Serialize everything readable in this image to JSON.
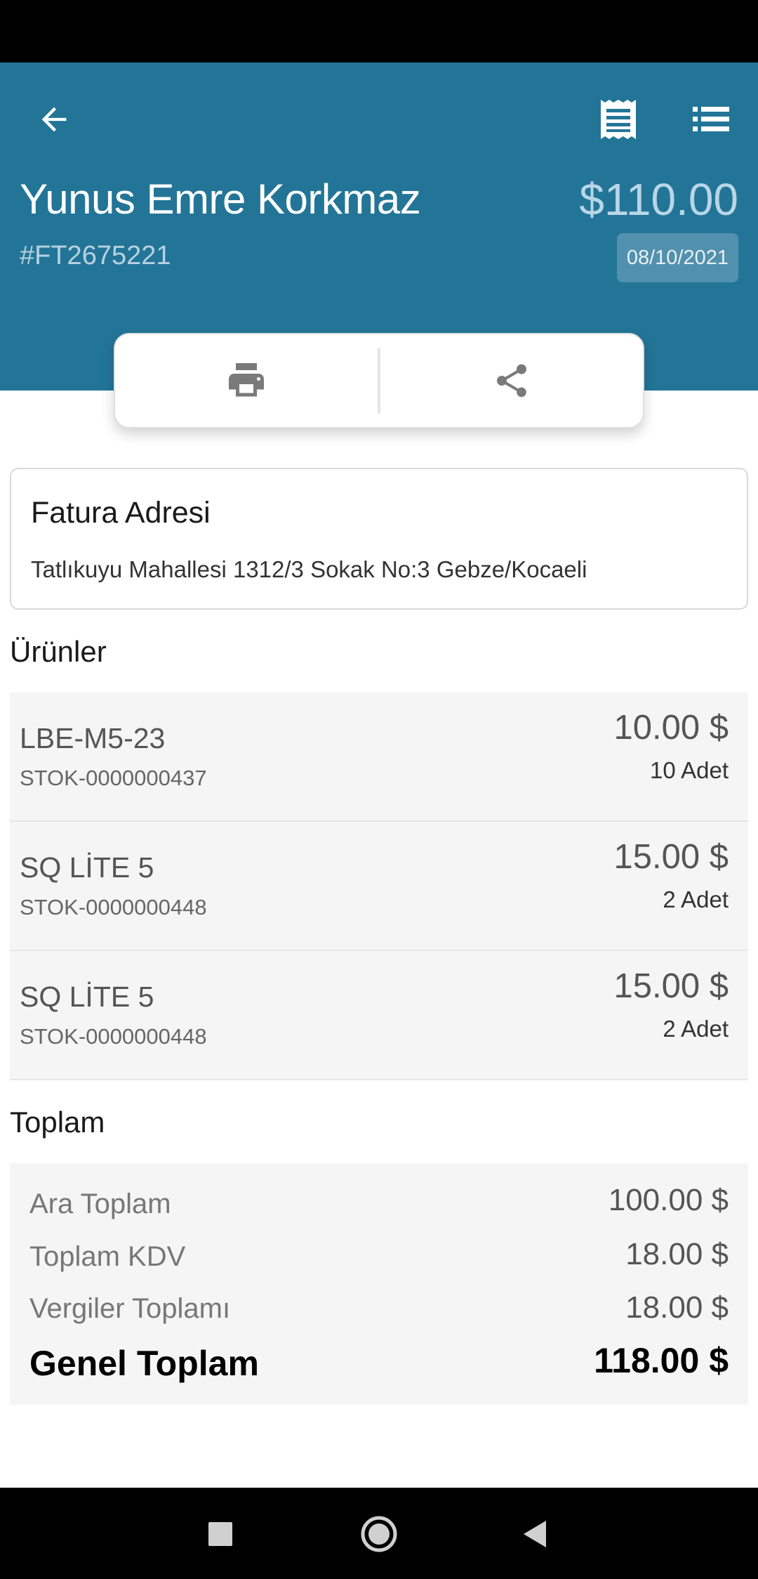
{
  "header": {
    "customer_name": "Yunus Emre Korkmaz",
    "invoice_number": "#FT2675221",
    "total_amount": "$110.00",
    "date": "08/10/2021",
    "icons": [
      "back-arrow-icon",
      "receipt-icon",
      "list-icon"
    ]
  },
  "actions": {
    "icons": [
      "print-icon",
      "share-icon"
    ]
  },
  "address": {
    "title": "Fatura Adresi",
    "text": "Tatlıkuyu Mahallesi 1312/3 Sokak No:3 Gebze/Kocaeli"
  },
  "products": {
    "title": "Ürünler",
    "items": [
      {
        "name": "LBE-M5-23",
        "code": "STOK-0000000437",
        "price": "10.00 $",
        "quantity": "10 Adet"
      },
      {
        "name": "SQ LİTE 5",
        "code": "STOK-0000000448",
        "price": "15.00 $",
        "quantity": "2 Adet"
      },
      {
        "name": "SQ LİTE 5",
        "code": "STOK-0000000448",
        "price": "15.00 $",
        "quantity": "2 Adet"
      }
    ]
  },
  "totals": {
    "title": "Toplam",
    "subtotal_label": "Ara Toplam",
    "subtotal_value": "100.00 $",
    "vat_label": "Toplam KDV",
    "vat_value": "18.00 $",
    "taxes_label": "Vergiler Toplamı",
    "taxes_value": "18.00 $",
    "grand_label": "Genel Toplam",
    "grand_value": "118.00 $"
  },
  "colors": {
    "header_bg": "#237598",
    "date_badge_bg": "#5291ad",
    "row_bg": "#f5f5f5"
  },
  "nav_bar": {
    "icons": [
      "recent-apps-icon",
      "home-icon",
      "back-nav-icon"
    ]
  }
}
